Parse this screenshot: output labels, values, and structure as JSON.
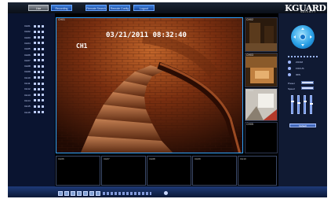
{
  "app": {
    "logo_main": "KGUARD",
    "logo_sub": "SECURITY"
  },
  "top_tabs": [
    {
      "label": "Live",
      "active": true
    },
    {
      "label": "Recording",
      "active": false
    },
    {
      "label": "Remote Search",
      "active": false
    },
    {
      "label": "Remote Config",
      "active": false
    },
    {
      "label": "Logout",
      "active": false
    }
  ],
  "channels": [
    "CH01",
    "CH02",
    "CH03",
    "CH04",
    "CH05",
    "CH06",
    "CH07",
    "CH08",
    "CH09",
    "CH10",
    "CH11",
    "CH12",
    "CH13",
    "CH14",
    "CH15",
    "CH16"
  ],
  "main_view": {
    "channel": "CH01",
    "osd_timestamp": "03/21/2011 08:32:40",
    "osd_channel": "CH1"
  },
  "side_views": [
    {
      "label": "CH02"
    },
    {
      "label": "CH03"
    },
    {
      "label": "CH04"
    },
    {
      "label": "CH05"
    }
  ],
  "bottom_views": [
    {
      "label": "CH06"
    },
    {
      "label": "CH07"
    },
    {
      "label": "CH08"
    },
    {
      "label": "CH09"
    },
    {
      "label": "CH10"
    }
  ],
  "ptz": {
    "zoom_label": "ZOOM",
    "focus_label": "FOCUS",
    "iris_label": "IRIS",
    "preset_label": "Preset",
    "speed_label": "Speed",
    "default_label": "Default"
  },
  "colors": {
    "accent": "#2fa3ff",
    "panel": "#0a1430",
    "bar": "#1e3a78"
  }
}
